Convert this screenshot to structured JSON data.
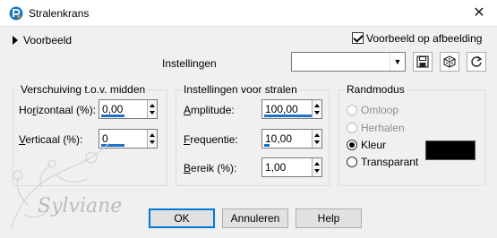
{
  "window": {
    "title": "Stralenkrans",
    "close_glyph": "✕"
  },
  "preview": {
    "toggle_label": "Voorbeeld",
    "on_image_label": "Voorbeeld op afbeelding",
    "on_image_checked": true
  },
  "settings": {
    "label": "Instellingen",
    "preset_value": "",
    "icons": [
      "save-icon",
      "randomize-dice-icon",
      "reset-icon"
    ]
  },
  "offset_group": {
    "title": "Verschuiving t.o.v. midden",
    "horizontal": {
      "label_pre": "Ho",
      "label_accel": "r",
      "label_post": "izontaal (%):",
      "value": "0,00",
      "fill": 0.5
    },
    "vertical": {
      "label_pre": "",
      "label_accel": "V",
      "label_post": "erticaal (%):",
      "value": "0",
      "fill": 0.5
    }
  },
  "ray_group": {
    "title": "Instellingen voor stralen",
    "amplitude": {
      "label_pre": "",
      "label_accel": "A",
      "label_post": "mplitude:",
      "value": "100,00",
      "fill": 1.0
    },
    "frequency": {
      "label_pre": "",
      "label_accel": "F",
      "label_post": "requentie:",
      "value": "10,00",
      "fill": 0.1
    },
    "range": {
      "label_pre": "",
      "label_accel": "B",
      "label_post": "ereik (%):",
      "value": "1,00",
      "fill": 0.0
    }
  },
  "edge_group": {
    "title": "Randmodus",
    "options": [
      {
        "label": "Omloop",
        "state": "disabled"
      },
      {
        "label": "Herhalen",
        "state": "disabled"
      },
      {
        "label": "Kleur",
        "state": "selected"
      },
      {
        "label": "Transparant",
        "state": "normal"
      }
    ],
    "color": "#000000"
  },
  "buttons": {
    "ok": "OK",
    "cancel": "Annuleren",
    "help": "Help"
  },
  "watermark": {
    "text": "Sylviane"
  }
}
